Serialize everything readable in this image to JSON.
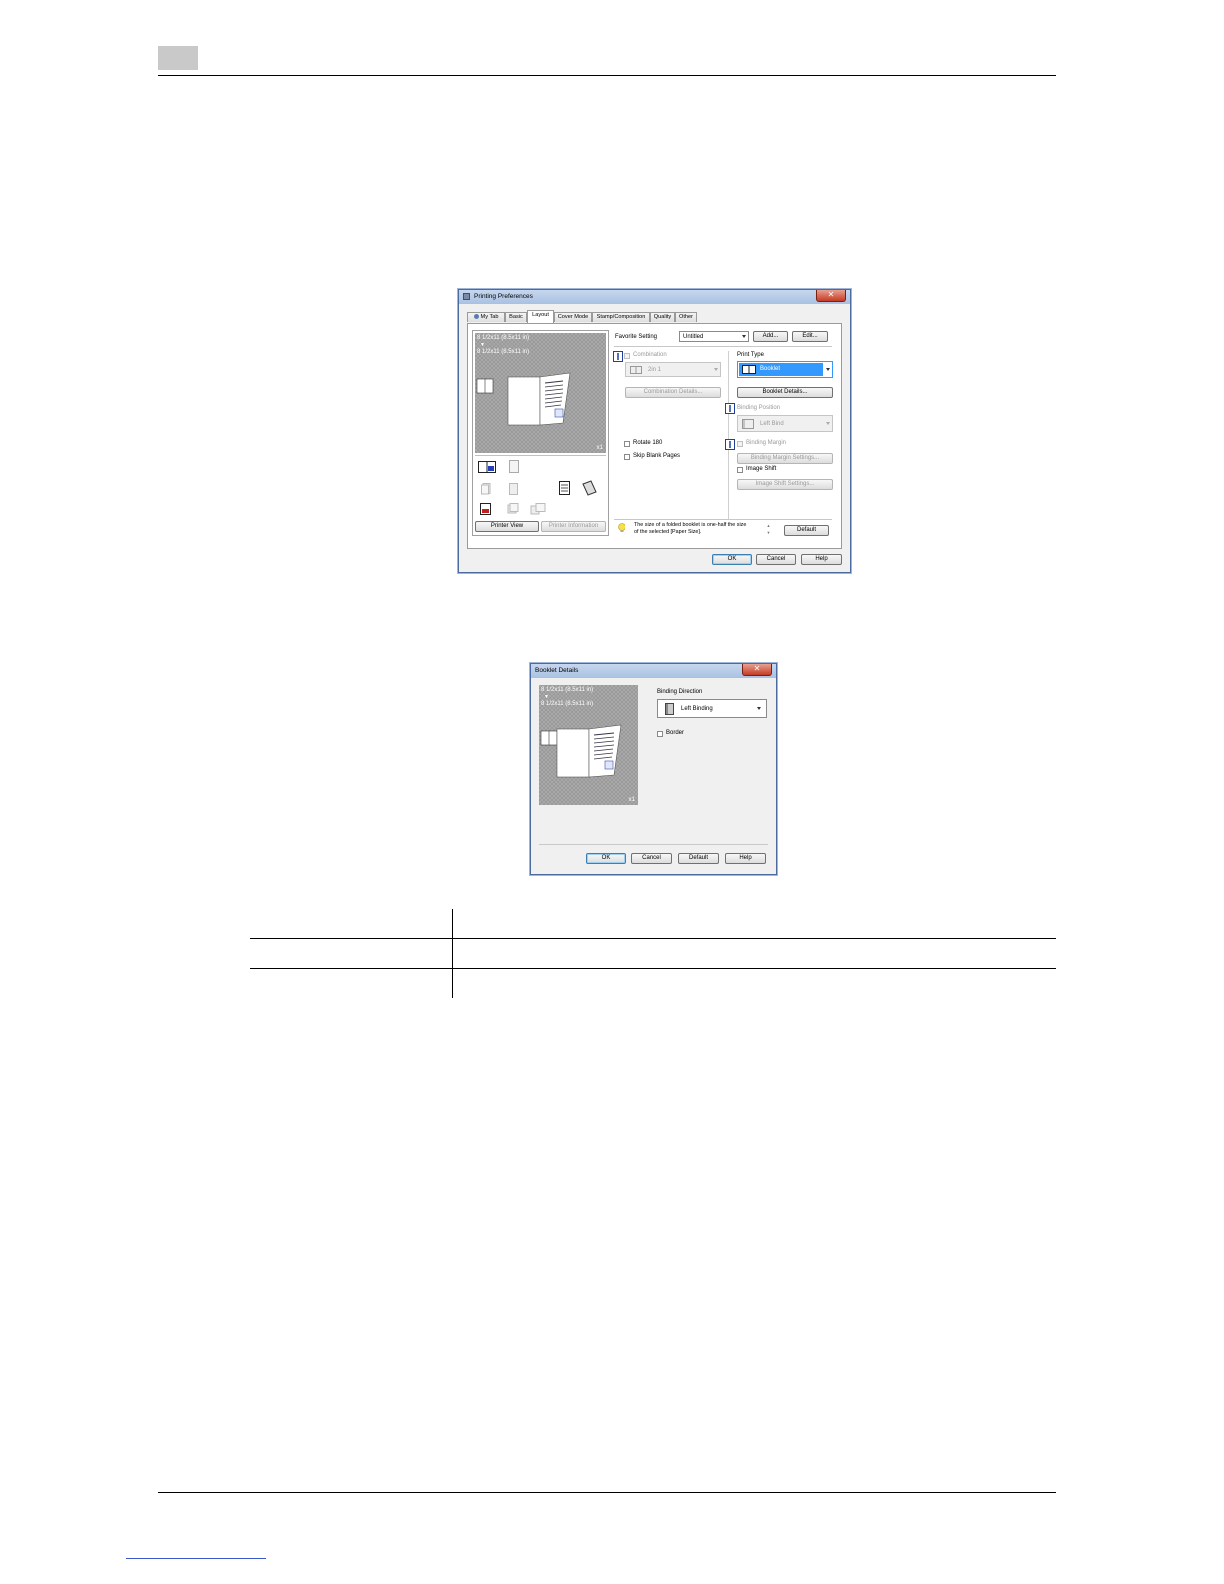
{
  "dialog1": {
    "title": "Printing Preferences",
    "tabs": [
      "My Tab",
      "Basic",
      "Layout",
      "Cover Mode",
      "Stamp/Composition",
      "Quality",
      "Other"
    ],
    "active_tab": "Layout",
    "preview": {
      "paper_from": "8 1/2x11 (8.5x11 in)",
      "arrow": "▼",
      "paper_to": "8 1/2x11 (8.5x11 in)",
      "copies": "x1"
    },
    "printer_view_button": "Printer View",
    "printer_information_button": "Printer Information",
    "favorite_setting_label": "Favorite Setting",
    "favorite_setting_value": "Untitled",
    "add_button": "Add...",
    "edit_button": "Edit...",
    "combination_label": "Combination",
    "combination_value": "2in 1",
    "combination_details_button": "Combination Details...",
    "rotate_label": "Rotate 180",
    "skip_blank_label": "Skip Blank Pages",
    "print_type_label": "Print Type",
    "print_type_value": "Booklet",
    "booklet_details_button": "Booklet Details...",
    "binding_position_label": "Binding Position",
    "binding_position_value": "Left Bind",
    "binding_margin_label": "Binding Margin",
    "binding_margin_settings_button": "Binding Margin Settings...",
    "image_shift_label": "Image Shift",
    "image_shift_settings_button": "Image Shift Settings...",
    "hint_line1": "The size of a folded booklet is one-half the size",
    "hint_line2": "of the selected [Paper Size].",
    "default_button": "Default",
    "ok_button": "OK",
    "cancel_button": "Cancel",
    "help_button": "Help"
  },
  "dialog2": {
    "title": "Booklet Details",
    "preview": {
      "paper_from": "8 1/2x11 (8.5x11 in)",
      "arrow": "▼",
      "paper_to": "8 1/2x11 (8.5x11 in)",
      "copies": "x1"
    },
    "binding_direction_label": "Binding Direction",
    "binding_direction_value": "Left Binding",
    "border_label": "Border",
    "ok_button": "OK",
    "cancel_button": "Cancel",
    "default_button": "Default",
    "help_button": "Help"
  },
  "colors": {
    "selection_blue": "#3399ff",
    "title_close_red": "#c43b25"
  }
}
